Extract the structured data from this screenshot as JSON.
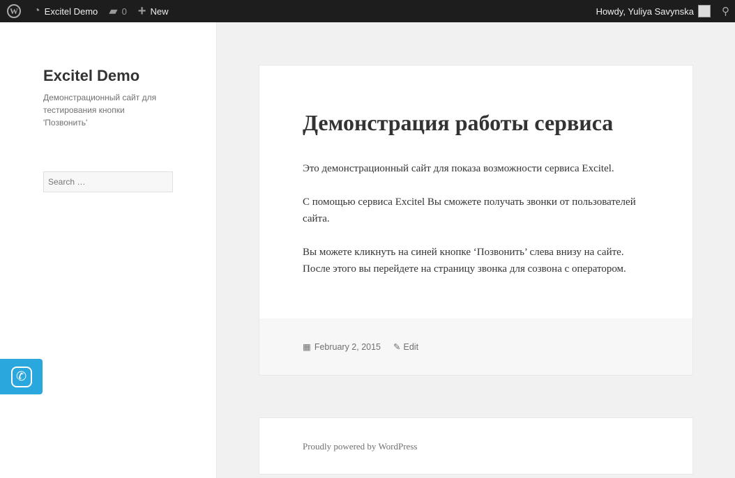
{
  "adminbar": {
    "site": "Excitel Demo",
    "comments": "0",
    "new": "New",
    "howdy": "Howdy, Yuliya Savynska"
  },
  "sidebar": {
    "title": "Excitel Demo",
    "description": "Демонстрационный сайт для тестирования кнопки 'Позвонить'",
    "search_placeholder": "Search …"
  },
  "post": {
    "title": "Демонстрация работы сервиса",
    "paragraphs": [
      "Это демонстрационный сайт для показа возможности сервиса Excitel.",
      "С помощью сервиса Excitel Вы сможете получать звонки от пользователей сайта.",
      "Вы можете кликнуть на синей кнопке ‘Позвонить’ слева внизу на сайте. После этого вы перейдете на страницу звонка для созвона с оператором."
    ],
    "date": "February 2, 2015",
    "edit": "Edit"
  },
  "footer": {
    "text": "Proudly powered by WordPress"
  }
}
